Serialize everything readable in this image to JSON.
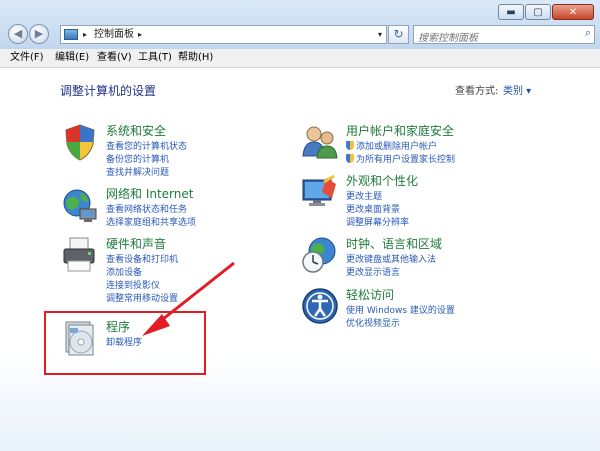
{
  "window": {
    "controls": {
      "minimize": "▬",
      "maximize": "▢",
      "close": "✕"
    }
  },
  "nav": {
    "back": "◀",
    "forward": "▶",
    "address": {
      "chevron": "▸",
      "path": "控制面板",
      "sep": "▸",
      "dropdown": "▾"
    },
    "refresh": "↻",
    "search": {
      "placeholder": "搜索控制面板",
      "icon": "⌕"
    }
  },
  "menu": {
    "items": [
      "文件(F)",
      "编辑(E)",
      "查看(V)",
      "工具(T)",
      "帮助(H)"
    ]
  },
  "main": {
    "title": "调整计算机的设置",
    "view_by": {
      "label": "查看方式:",
      "value": "类别 ▾"
    },
    "categories": [
      {
        "title": "系统和安全",
        "links": [
          "查看您的计算机状态",
          "备份您的计算机",
          "查找并解决问题"
        ]
      },
      {
        "title": "网络和 Internet",
        "links": [
          "查看网络状态和任务",
          "选择家庭组和共享选项"
        ]
      },
      {
        "title": "硬件和声音",
        "links": [
          "查看设备和打印机",
          "添加设备",
          "连接到投影仪",
          "调整常用移动设置"
        ]
      },
      {
        "title": "程序",
        "links": [
          "卸载程序"
        ]
      },
      {
        "title": "用户帐户和家庭安全",
        "links": [
          "添加或删除用户帐户",
          "为所有用户设置家长控制"
        ]
      },
      {
        "title": "外观和个性化",
        "links": [
          "更改主题",
          "更改桌面背景",
          "调整屏幕分辨率"
        ]
      },
      {
        "title": "时钟、语言和区域",
        "links": [
          "更改键盘或其他输入法",
          "更改显示语言"
        ]
      },
      {
        "title": "轻松访问",
        "links": [
          "使用 Windows 建议的设置",
          "优化视频显示"
        ]
      }
    ]
  },
  "colors": {
    "category_title": "#1f7b3b",
    "link": "#2a59b8",
    "page_title": "#1e3287",
    "annotation": "#e31b23"
  }
}
